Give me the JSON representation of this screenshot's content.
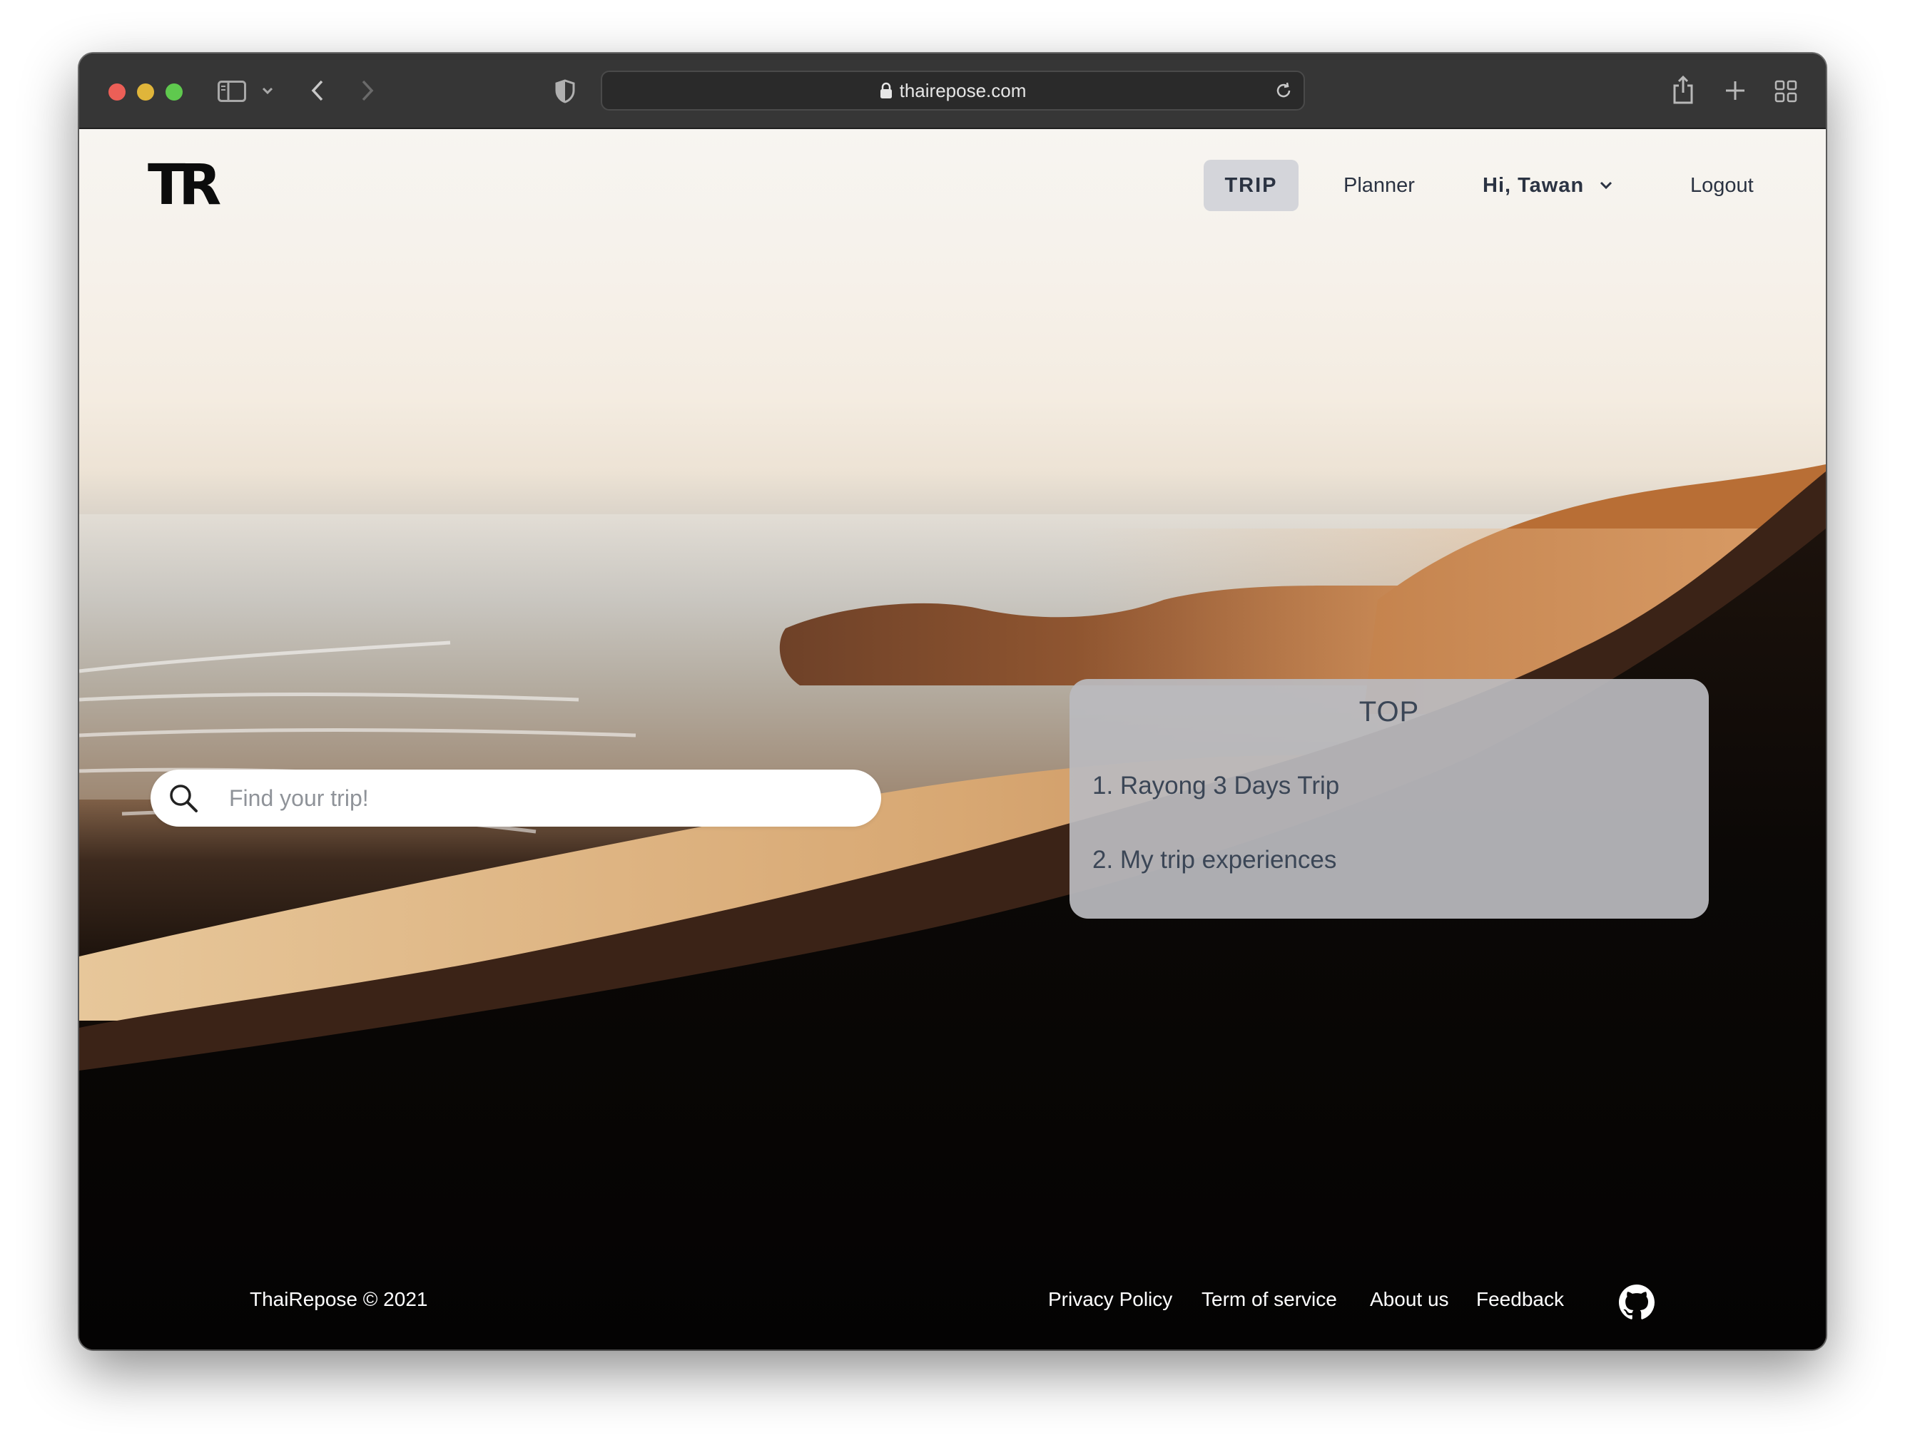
{
  "browser": {
    "url": "thairepose.com"
  },
  "header": {
    "logo": "TR",
    "nav": {
      "trip": "TRIP",
      "planner": "Planner",
      "user": "Hi, Tawan",
      "logout": "Logout"
    }
  },
  "search": {
    "placeholder": "Find your trip!"
  },
  "top": {
    "title": "TOP",
    "items": [
      "1. Rayong 3 Days Trip",
      "2. My trip experiences"
    ]
  },
  "footer": {
    "copyright": "ThaiRepose © 2021",
    "links": [
      "Privacy Policy",
      "Term of service",
      "About us",
      "Feedback"
    ]
  },
  "icons": {
    "github": "github-icon",
    "search": "search-icon"
  }
}
